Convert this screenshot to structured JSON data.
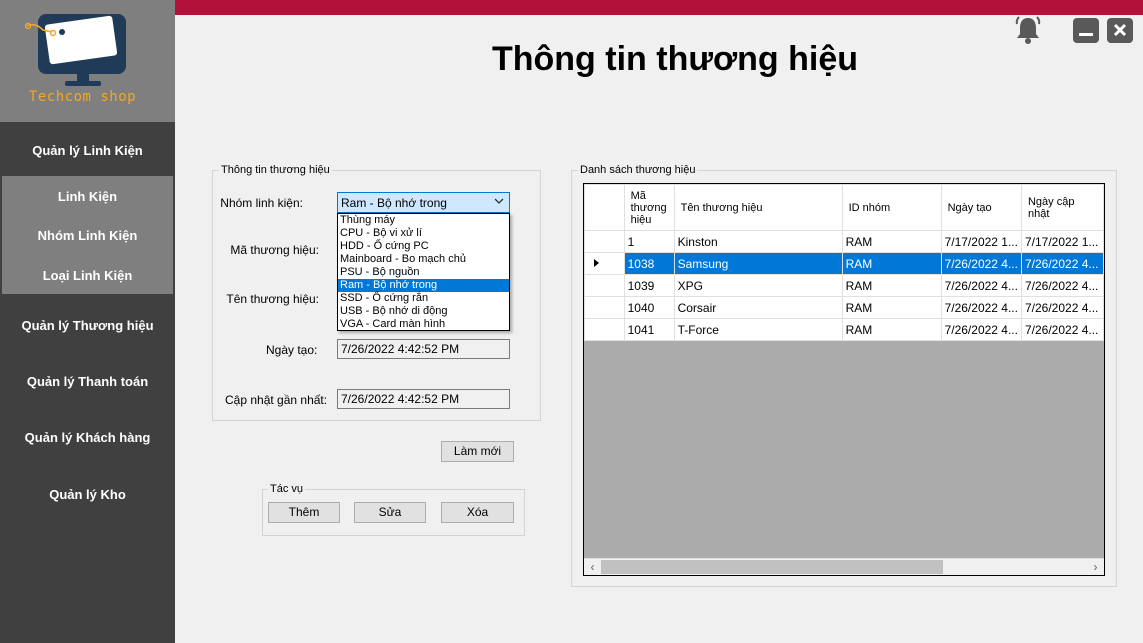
{
  "app": {
    "title": "Thông tin thương hiệu",
    "logo_text": "Techcom shop"
  },
  "colors": {
    "sidebar_bg": "#404040",
    "sidebar_active_bg": "#7f7f7f",
    "topbar": "#b3103a",
    "accent": "#0078d7",
    "logo_text": "#f5a623"
  },
  "sidebar": {
    "items": [
      {
        "label": "Quản lý Linh Kiện"
      },
      {
        "label": "Quản lý Thương hiệu"
      },
      {
        "label": "Quản lý Thanh toán"
      },
      {
        "label": "Quản lý Khách hàng"
      },
      {
        "label": "Quản lý Kho"
      }
    ],
    "subitems": [
      {
        "label": "Linh Kiện"
      },
      {
        "label": "Nhóm Linh Kiện"
      },
      {
        "label": "Loại Linh Kiện"
      }
    ]
  },
  "icons": {
    "bell": "bell-icon",
    "minimize": "minimize-icon",
    "close": "close-icon"
  },
  "form": {
    "legend": "Thông tin thương hiệu",
    "group_label": "Nhóm linh kiện:",
    "code_label": "Mã thương hiệu:",
    "name_label": "Tên thương hiệu:",
    "created_label": "Ngày tạo:",
    "updated_label": "Cập nhật gần nhất:",
    "group_value": "Ram - Bộ nhớ trong",
    "created_value": "7/26/2022 4:42:52 PM",
    "updated_value": "7/26/2022 4:42:52 PM",
    "dropdown_options": [
      "Thùng máy",
      "CPU - Bộ vi xử lí",
      "HDD - Ổ cứng PC",
      "Mainboard - Bo mạch chủ",
      "PSU - Bộ nguồn",
      "Ram - Bộ nhớ trong",
      "SSD - Ổ cứng rắn",
      "USB - Bộ nhớ di động",
      "VGA - Card màn hình"
    ],
    "selected_option": "Ram - Bộ nhớ trong",
    "refresh_label": "Làm mới"
  },
  "actions": {
    "legend": "Tác vụ",
    "add_label": "Thêm",
    "edit_label": "Sửa",
    "delete_label": "Xóa"
  },
  "list": {
    "legend": "Danh sách thương hiệu",
    "columns": [
      "Mã thương hiệu",
      "Tên thương hiệu",
      "ID nhóm",
      "Ngày tạo",
      "Ngày cập nhật"
    ],
    "rows": [
      [
        "1",
        "Kinston",
        "RAM",
        "7/17/2022 1...",
        "7/17/2022 1..."
      ],
      [
        "1038",
        "Samsung",
        "RAM",
        "7/26/2022 4...",
        "7/26/2022 4..."
      ],
      [
        "1039",
        "XPG",
        "RAM",
        "7/26/2022 4...",
        "7/26/2022 4..."
      ],
      [
        "1040",
        "Corsair",
        "RAM",
        "7/26/2022 4...",
        "7/26/2022 4..."
      ],
      [
        "1041",
        "T-Force",
        "RAM",
        "7/26/2022 4...",
        "7/26/2022 4..."
      ]
    ],
    "selected_row": 1
  }
}
